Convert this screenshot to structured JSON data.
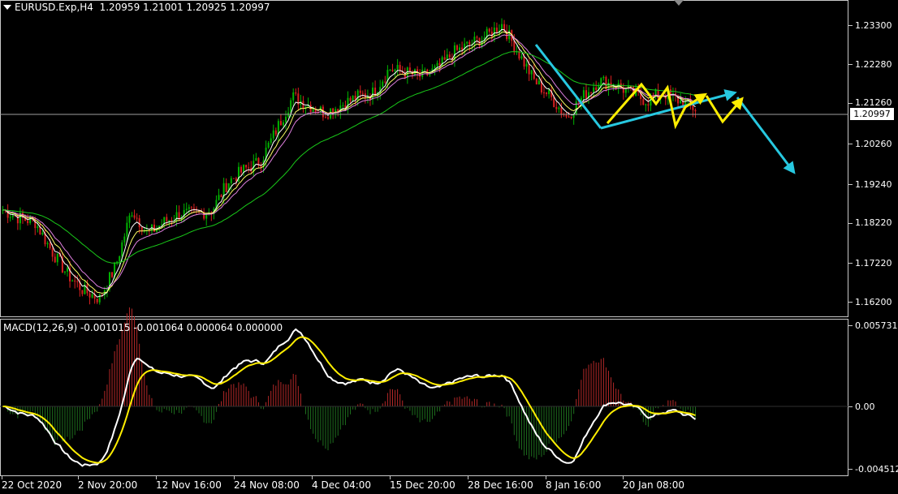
{
  "header": {
    "symbol": "EURUSD.Exp,H4",
    "ohlc": "1.20959 1.21001 1.20925 1.20997"
  },
  "price_axis": {
    "labels": [
      "1.23300",
      "1.22280",
      "1.21260",
      "1.20260",
      "1.19240",
      "1.18220",
      "1.17220",
      "1.16200"
    ],
    "current": "1.20997"
  },
  "macd": {
    "title": "MACD(12,26,9) -0.001015 -0.001064 0.000064 0.000000",
    "axis_labels": [
      "0.005731",
      "0.00",
      "-0.004512"
    ]
  },
  "time_axis": {
    "labels": [
      "22 Oct 2020",
      "2 Nov 20:00",
      "12 Nov 16:00",
      "24 Nov 08:00",
      "4 Dec 04:00",
      "15 Dec 20:00",
      "28 Dec 16:00",
      "8 Jan 16:00",
      "20 Jan 08:00"
    ]
  },
  "colors": {
    "bull": "#00b400",
    "bear": "#d82020",
    "ma_fast": "#ffffff",
    "ma_mid": "#ffff66",
    "ma_slow": "#e080e0",
    "ma_long": "#19c819",
    "cyan": "#27c8e0",
    "yellow": "#ffee00",
    "hist_pos": "#b42828",
    "hist_neg": "#1e6e1e",
    "macd_line": "#ffffff",
    "signal_line": "#ffee00"
  },
  "chart_data": {
    "type": "line",
    "title": "EURUSD.Exp,H4",
    "series": [
      {
        "name": "EURUSD.Exp,H4",
        "values": [
          1.186,
          1.184,
          1.183,
          1.176,
          1.17,
          1.166,
          1.164,
          1.172,
          1.186,
          1.18,
          1.183,
          1.185,
          1.185,
          1.186,
          1.193,
          1.196,
          1.198,
          1.206,
          1.214,
          1.212,
          1.21,
          1.212,
          1.214,
          1.215,
          1.221,
          1.22,
          1.219,
          1.221,
          1.225,
          1.227,
          1.229,
          1.232,
          1.225,
          1.218,
          1.214,
          1.209,
          1.214,
          1.218,
          1.217,
          1.215,
          1.213,
          1.215,
          1.213,
          1.211
        ]
      }
    ],
    "ylim": [
      1.16,
      1.236
    ]
  }
}
